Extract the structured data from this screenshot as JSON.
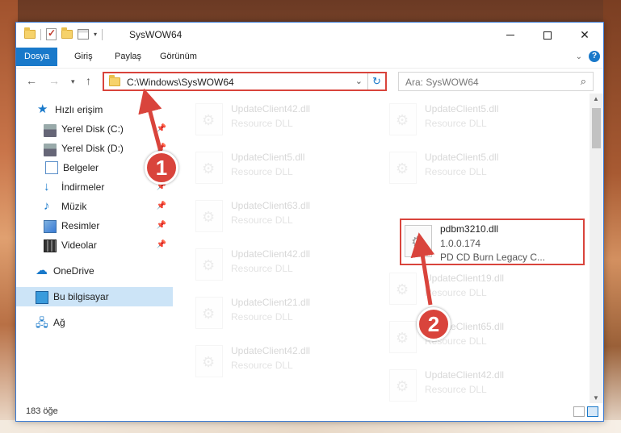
{
  "window": {
    "title": "SysWOW64"
  },
  "ribbon": {
    "tabs": [
      {
        "label": "Dosya"
      },
      {
        "label": "Giriş"
      },
      {
        "label": "Paylaş"
      },
      {
        "label": "Görünüm"
      }
    ],
    "help_icon": "?"
  },
  "nav": {
    "address": "C:\\Windows\\SysWOW64",
    "search_placeholder": "Ara: SysWOW64"
  },
  "sidebar": {
    "items": [
      {
        "label": "Hızlı erişim",
        "icon": "star-icon"
      },
      {
        "label": "Yerel Disk (C:)",
        "icon": "disk-icon"
      },
      {
        "label": "Yerel Disk (D:)",
        "icon": "disk-icon"
      },
      {
        "label": "Belgeler",
        "icon": "document-icon"
      },
      {
        "label": "İndirmeler",
        "icon": "download-icon"
      },
      {
        "label": "Müzik",
        "icon": "music-icon"
      },
      {
        "label": "Resimler",
        "icon": "pictures-icon"
      },
      {
        "label": "Videolar",
        "icon": "video-icon"
      },
      {
        "label": "OneDrive",
        "icon": "cloud-icon"
      },
      {
        "label": "Bu bilgisayar",
        "icon": "computer-icon"
      },
      {
        "label": "Ağ",
        "icon": "network-icon"
      }
    ]
  },
  "files": [
    {
      "name": "UpdateClient42.dll",
      "type": "Resource DLL"
    },
    {
      "name": "UpdateClient5.dll",
      "type": "Resource DLL"
    },
    {
      "name": "UpdateClient5.dll",
      "type": "Resource DLL"
    },
    {
      "name": "UpdateClient5.dll",
      "type": "Resource DLL"
    },
    {
      "name": "UpdateClient63.dll",
      "type": "Resource DLL"
    },
    {
      "name": "pdbm3210.dll",
      "version": "1.0.0.174",
      "description": "PD CD Burn Legacy C..."
    },
    {
      "name": "UpdateClient42.dll",
      "type": "Resource DLL"
    },
    {
      "name": "UpdateClient19.dll",
      "type": "Resource DLL"
    },
    {
      "name": "UpdateClient21.dll",
      "type": "Resource DLL"
    },
    {
      "name": "UpdateClient65.dll",
      "type": "Resource DLL"
    },
    {
      "name": "UpdateClient42.dll",
      "type": "Resource DLL"
    },
    {
      "name": "UpdateClient42.dll",
      "type": "Resource DLL"
    }
  ],
  "status": {
    "count": "183 öğe"
  },
  "annotations": {
    "step1": "1",
    "step2": "2",
    "color": "#d9443c"
  }
}
